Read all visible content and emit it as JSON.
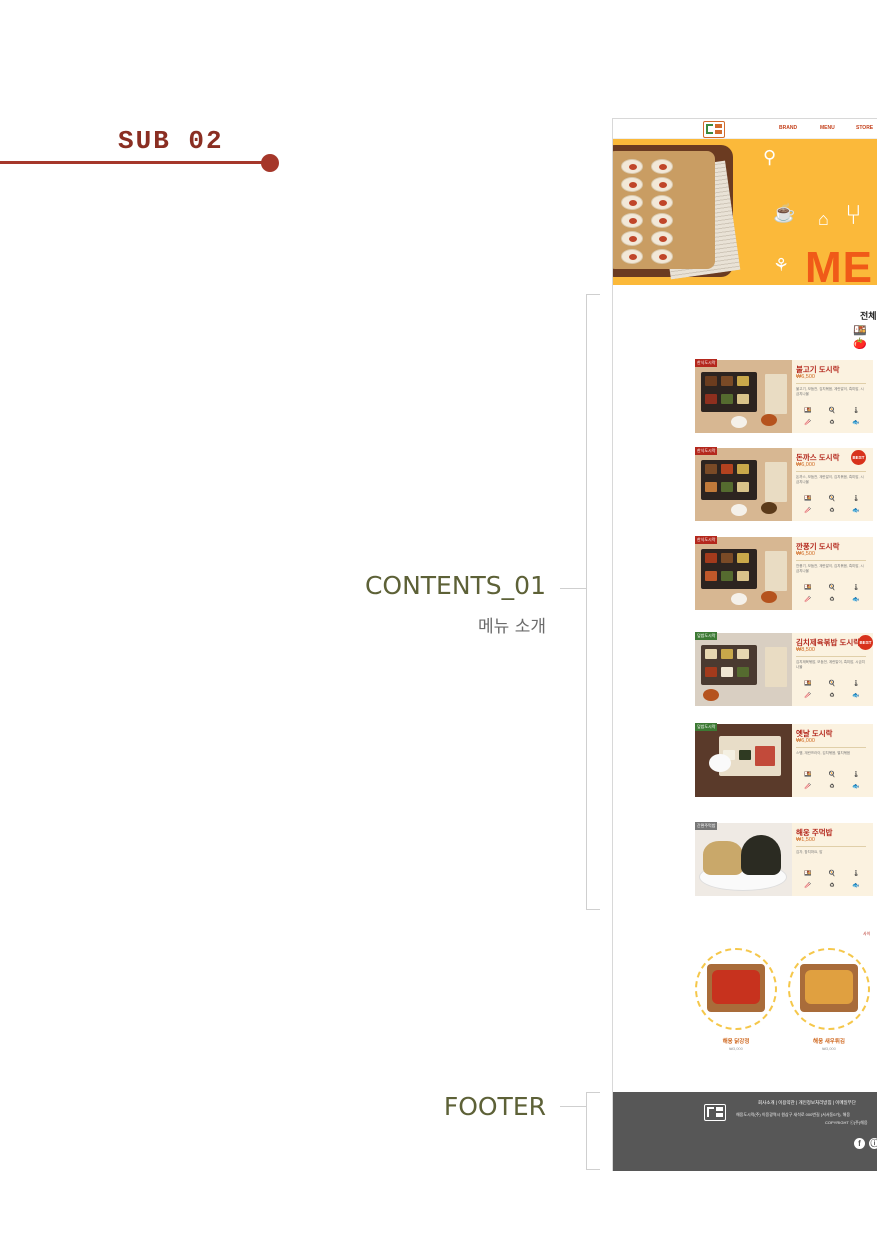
{
  "annotation": {
    "sub_title": "SUB 02",
    "contents_label": "CONTENTS_01",
    "contents_sub": "메뉴 소개",
    "footer_label": "FOOTER"
  },
  "mockup": {
    "nav": [
      "BRAND",
      "MENU",
      "STORE"
    ],
    "hero_text": "ME",
    "category_title": "전체",
    "menu_items": [
      {
        "tag": "한식도시락",
        "name": "불고기 도시락",
        "price": "₩6,500",
        "desc": "불고기, 모둠전, 김치볶음, 계란말이, 흑미밥, 시금치나물",
        "best": ""
      },
      {
        "tag": "한식도시락",
        "name": "돈까스 도시락",
        "price": "₩6,000",
        "desc": "돈까스, 모둠전, 계란말이, 김치볶음, 흑미밥, 시금치나물",
        "best": "BEST"
      },
      {
        "tag": "한식도시락",
        "name": "깐풍기 도시락",
        "price": "₩6,500",
        "desc": "깐풍기, 모둠전, 계란말이, 김치볶음, 흑미밥, 시금치나물",
        "best": ""
      },
      {
        "tag": "덮밥도시락",
        "name": "김치제육볶밥 도시락",
        "price": "₩8,500",
        "desc": "김치제육볶밥, 모둠전, 계란말이, 흑미밥, 시금치나물",
        "best": "BEST"
      },
      {
        "tag": "덮밥도시락",
        "name": "옛날 도시락",
        "price": "₩6,000",
        "desc": "스팸, 계란프라이, 김치볶음, 멸치볶음",
        "best": ""
      },
      {
        "tag": "간편주먹밥",
        "name": "해웅 주먹밥",
        "price": "₩1,500",
        "desc": "김자, 참치마요, 밥",
        "best": ""
      }
    ],
    "card_icons": [
      "🍱",
      "🍳",
      "🌡",
      "🥢",
      "♻",
      "🐟"
    ],
    "side_note": "사이",
    "side_items": [
      {
        "name": "해웅 닭강정",
        "price": "₩3,000"
      },
      {
        "name": "해웅 새우튀김",
        "price": "₩3,000"
      }
    ],
    "footer": {
      "links": "회사소개 | 이용약관 | 개인정보처리방침 | 이메일무단",
      "info": "해웅도시락(주) 이웅광역시 원삼구 새석로 000번길 (서서동0가), 해웅",
      "copyright": "COPYRIGHT ⓒ(주)해웅",
      "social": [
        "f",
        "ⓘ"
      ]
    }
  },
  "colors": {
    "accent_red": "#a5372a",
    "label_olive": "#5d6137",
    "hero_yellow": "#fbb93a",
    "hero_orange": "#f05a18",
    "footer_gray": "#575757"
  }
}
